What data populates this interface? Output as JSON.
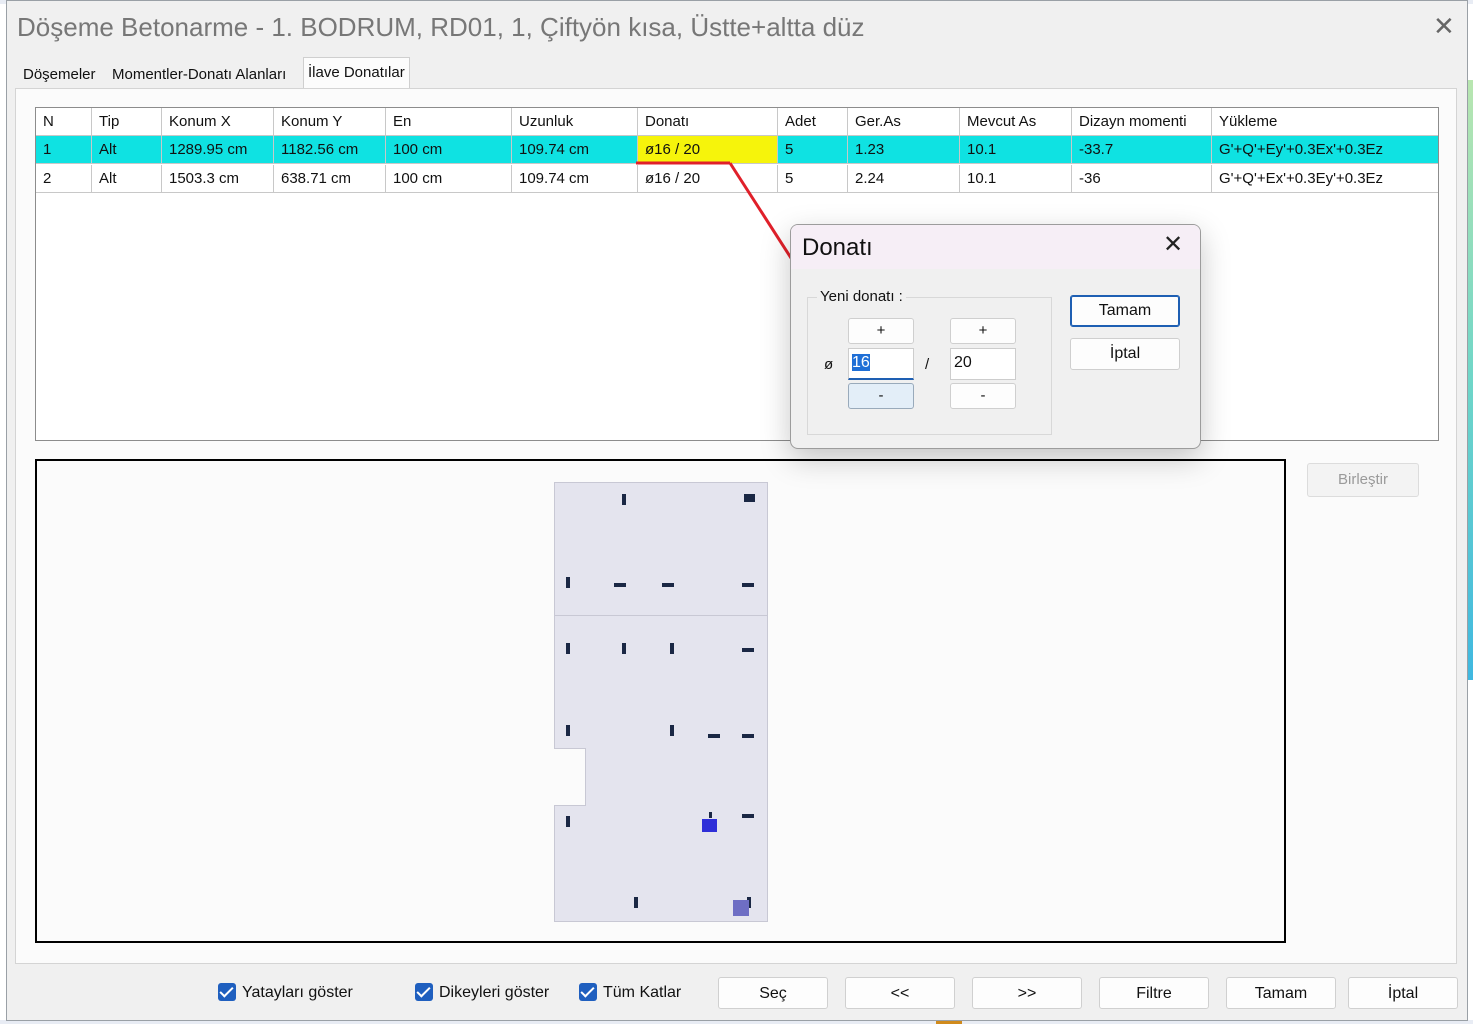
{
  "window": {
    "title": "Döşeme Betonarme - 1. BODRUM, RD01, 1, Çiftyön kısa, Üstte+altta düz",
    "close_glyph": "✕"
  },
  "tabs": [
    "Döşemeler",
    "Momentler-Donatı Alanları",
    "İlave Donatılar"
  ],
  "table": {
    "headers": [
      "N",
      "Tip",
      "Konum X",
      "Konum Y",
      "En",
      "Uzunluk",
      "Donatı",
      "Adet",
      "Ger.As",
      "Mevcut As",
      "Dizayn momenti",
      "Yükleme"
    ],
    "rows": [
      [
        "1",
        "Alt",
        "1289.95 cm",
        "1182.56 cm",
        "100 cm",
        "109.74 cm",
        "ø16 / 20",
        "5",
        "1.23",
        "10.1",
        "-33.7",
        "G'+Q'+Ey'+0.3Ex'+0.3Ez"
      ],
      [
        "2",
        "Alt",
        "1503.3 cm",
        "638.71 cm",
        "100 cm",
        "109.74 cm",
        "ø16 / 20",
        "5",
        "2.24",
        "10.1",
        "-36",
        "G'+Q'+Ex'+0.3Ey'+0.3Ez"
      ]
    ]
  },
  "buttons": {
    "merge": "Birleştir",
    "select": "Seç",
    "prev": "<<",
    "next": ">>",
    "filter": "Filtre",
    "ok": "Tamam",
    "cancel": "İptal"
  },
  "checkboxes": [
    {
      "label": "Yatayları göster",
      "checked": true
    },
    {
      "label": "Dikeyleri göster",
      "checked": true
    },
    {
      "label": "Tüm Katlar",
      "checked": true
    }
  ],
  "dialog": {
    "title": "Donatı",
    "close_glyph": "✕",
    "group_label": "Yeni donatı :",
    "phi": "ø",
    "slash": "/",
    "diameter": "16",
    "spacing": "20",
    "plus": "+",
    "minus": "-",
    "ok": "Tamam",
    "cancel": "İptal"
  },
  "colors": {
    "selected_row": "#0fe2e2",
    "highlight_cell": "#f6f40b",
    "callout_line": "#e0202a",
    "accent": "#1f5fbf"
  }
}
